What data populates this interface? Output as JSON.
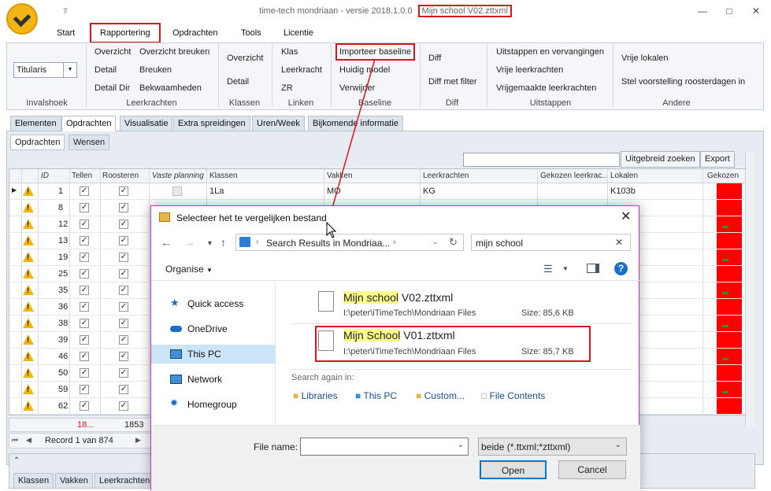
{
  "window": {
    "title": "time-tech mondriaan - versie 2018.1.0.0",
    "file": "Mijn school V02.zttxml",
    "qat": "⫪",
    "min": "—",
    "max": "□",
    "close": "✕"
  },
  "menu": [
    "Start",
    "Rapportering",
    "Opdrachten",
    "Tools",
    "Licentie"
  ],
  "ribbon": {
    "titularis": "Titularis",
    "groups": {
      "invalshoek": "Invalshoek",
      "leerkrachten": "Leerkrachten",
      "klassen": "Klassen",
      "linken": "Linken",
      "baseline": "Baseline",
      "diff": "Diff",
      "uitstappen": "Uitstappen",
      "andere": "Andere"
    },
    "leerkrachten_items": [
      "Overzicht",
      "Detail",
      "Detail Dir",
      "Overzicht breuken",
      "Breuken",
      "Bekwaamheden"
    ],
    "klassen_items": [
      "Overzicht",
      "Detail"
    ],
    "linken_items": [
      "Klas",
      "Leerkracht",
      "ZR"
    ],
    "baseline_items": [
      "Importeer baseline",
      "Huidig model",
      "Verwijder"
    ],
    "diff_items": [
      "Diff",
      "Diff met filter"
    ],
    "uitstappen_items": [
      "Uitstappen en vervangingen",
      "Vrije leerkrachten",
      "Vrijgemaakte leerkrachten"
    ],
    "andere_items": [
      "Vrije lokalen",
      "Stel voorstelling roosterdagen in"
    ]
  },
  "doc_tabs": [
    "Elementen",
    "Opdrachten",
    "Visualisatie",
    "Extra spreidingen",
    "Uren/Week",
    "Bijkomende informatie"
  ],
  "sub_tabs": [
    "Opdrachten",
    "Wensen"
  ],
  "grid_toolbar": {
    "search_clear": "✕",
    "advanced": "Uitgebreid zoeken",
    "export": "Export"
  },
  "grid": {
    "columns": [
      "ID",
      "Tellen",
      "Roosteren",
      "Vaste planning",
      "Klassen",
      "Vakken",
      "Leerkrachten",
      "Gekozen leerkrac...",
      "Lokalen",
      "Gekozen"
    ],
    "first_row": {
      "id": "1",
      "klassen": "1La",
      "vakken": "MO",
      "leerkrachten": "KG",
      "lokalen": "K103b"
    },
    "ids": [
      "8",
      "12",
      "13",
      "19",
      "25",
      "35",
      "36",
      "38",
      "39",
      "46",
      "50",
      "59",
      "62"
    ],
    "footer_count": "18...",
    "footer_total": "1853",
    "record": "Record 1 van 874"
  },
  "bottom_tabs": [
    "Klassen",
    "Vakken",
    "Leerkrachten"
  ],
  "dialog": {
    "title": "Selecteer het te vergelijken bestand",
    "close": "✕",
    "address": "Search Results in Mondriaa...",
    "search_value": "mijn school",
    "organise": "Organise",
    "nav": [
      "Quick access",
      "OneDrive",
      "This PC",
      "Network",
      "Homegroup"
    ],
    "files": [
      {
        "name_hl": "Mijn school",
        "name_rest": " V02.zttxml",
        "path": "I:\\peter\\iTimeTech\\Mondriaan Files",
        "size": "Size: 85,6 KB"
      },
      {
        "name_hl": "Mijn School",
        "name_rest": " V01.zttxml",
        "path": "I:\\peter\\iTimeTech\\Mondriaan Files",
        "size": "Size: 85,7 KB"
      }
    ],
    "search_again": "Search again in:",
    "search_again_items": [
      "Libraries",
      "This PC",
      "Custom...",
      "File Contents"
    ],
    "file_name_label": "File name:",
    "file_name_value": "",
    "filter": "beide (*.ttxml;*zttxml)",
    "open": "Open",
    "cancel": "Cancel"
  },
  "colors": {
    "highlight_red": "#d9141c",
    "status_red": "#ff0000",
    "accent_blue": "#0078d7"
  }
}
